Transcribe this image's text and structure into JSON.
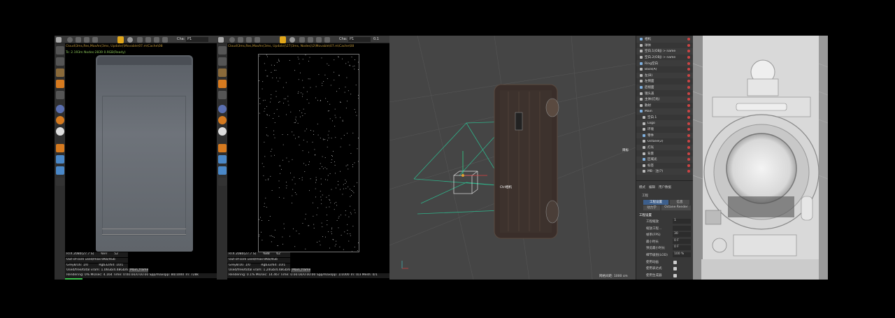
{
  "left_viewer": {
    "camera_label": "Cha:",
    "camera_value": "P1",
    "path": "Cloud\\3ms,Res,MaxAn(3ms, Update)\\Movable\\07.m\\Cache\\08",
    "render_info": "Ts: 2.193m Nodes:2839  0.9GB(Ready)",
    "gpu": "RTX 2080(27.7 S)",
    "gpu_a": "%97",
    "gpu_b": "52",
    "outofcore": "Out-of-core used/max:0Kb/4Gb",
    "grey": "Grey8/16: 1/0",
    "rgb": "Rgb32/64: 10/1",
    "vram": "Used/free/total vram: 1.06Gb/4.48Gb/6Gb",
    "mainframe": "Main_frame",
    "status": "Rendering: 0%   Ms/sec: 4.164   Time: 0:00:00/0:00:00   Spp/maxspp: 80/1000   Tri: 728k"
  },
  "middle_viewer": {
    "camera_label": "Cha:",
    "camera_value": "P1",
    "extra": "0.1",
    "path": "Cloud\\3ms,Res,MaxAn(3ms, Update)\\27(3ms, Nodes)\\2\\Movable\\07.m\\Cache\\08",
    "gpu": "RTX 2080(27.7 S)",
    "gpu_a": "%88",
    "gpu_b": "62",
    "outofcore": "Out-of-core used/max:0Kb/4Gb",
    "grey": "Grey8/16: 1/0",
    "rgb": "Rgb32/64: 10/1",
    "vram": "Used/free/total vram: 1.24Gb/4.48Gb/6Gb",
    "mainframe": "Main_frame",
    "status": "Rendering: 0.1%   Ms/sec: 14.467   Time: 0:00:00/0:00:00   Spp/maxspp: 1/1000   Tri: 0/3   Mesh: 0/1"
  },
  "viewport": {
    "label_camera": "Ctrl相机",
    "label_target": "目标",
    "grid_label": "网格间距: 1000 cm"
  },
  "object_manager": {
    "items": [
      "相机",
      "球体",
      "空白.1(OBJ) > name",
      "空白.2(OBJ) > name",
      "Ring空白",
      "Back(A)",
      "左(B)",
      "左侧面",
      "后视面",
      "镜头盖",
      "主体(灯光)",
      "散射",
      "Main",
      "空白.1",
      "Logo",
      "环境",
      "零件",
      "Octane(2)",
      "灯光",
      "背景",
      "区域光",
      "标签",
      "MB · 注(7)"
    ]
  },
  "attributes": {
    "tabs": [
      "模式",
      "编辑",
      "用户数据"
    ],
    "section": "工程",
    "subtabs": [
      "工程设置",
      "信息"
    ],
    "subtabs2": [
      "动力学",
      "Octane Render"
    ],
    "title": "工程设置",
    "fields": [
      {
        "label": "工程缩放",
        "value": "1"
      },
      {
        "label": "缩放工程...",
        "value": ""
      },
      {
        "label": "帧率(FPS)",
        "value": "30"
      },
      {
        "label": "最小时长",
        "value": "0 F"
      },
      {
        "label": "预览最小时长",
        "value": "0 F"
      },
      {
        "label": "细节级别(LOD)",
        "value": "100 %"
      },
      {
        "label": "使用动画",
        "value": ""
      },
      {
        "label": "使用表达式",
        "value": ""
      },
      {
        "label": "使用生成器",
        "value": ""
      }
    ]
  }
}
